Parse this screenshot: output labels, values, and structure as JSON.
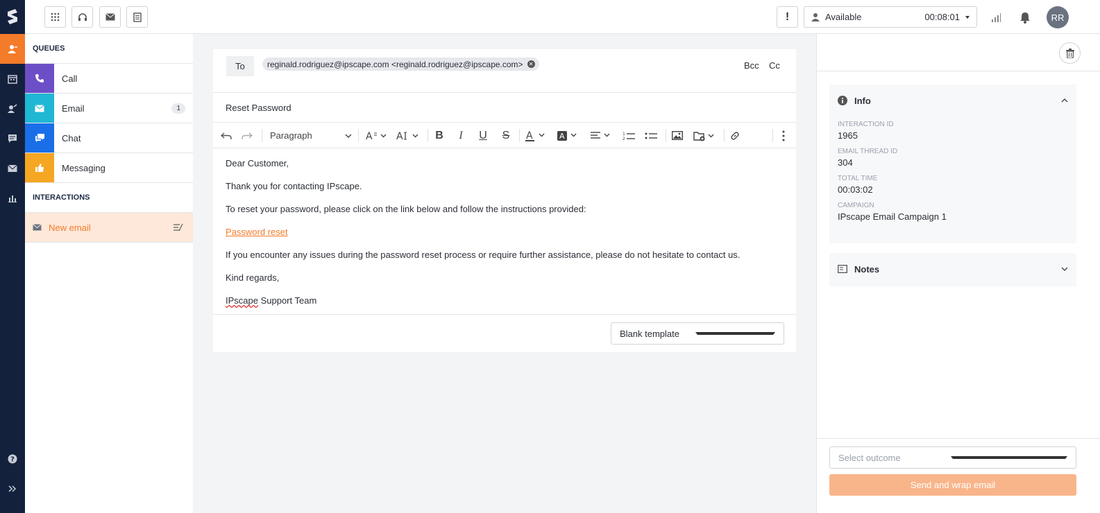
{
  "rail": {
    "logo": "s-logo-icon",
    "items": [
      "contact-icon",
      "calendar-icon",
      "agent-icon",
      "chat-icon",
      "email-icon",
      "reports-icon"
    ],
    "bottom": [
      "help-icon",
      "expand-icon"
    ]
  },
  "topbar": {
    "warning": "!",
    "status_label": "Available",
    "status_timer": "00:08:01",
    "avatar_initials": "RR"
  },
  "queues": {
    "heading": "QUEUES",
    "items": [
      {
        "label": "Call",
        "color": "#6c4fc7",
        "icon": "phone-icon"
      },
      {
        "label": "Email",
        "color": "#1fb7d4",
        "icon": "email-icon",
        "badge": "1"
      },
      {
        "label": "Chat",
        "color": "#1a6fe8",
        "icon": "chat-icon"
      },
      {
        "label": "Messaging",
        "color": "#f5a623",
        "icon": "thumbs-up-icon"
      }
    ]
  },
  "interactions": {
    "heading": "INTERACTIONS",
    "items": [
      {
        "label": "New email"
      }
    ]
  },
  "composer": {
    "to_label": "To",
    "recipient": "reginald.rodriguez@ipscape.com <reginald.rodriguez@ipscape.com>",
    "bcc": "Bcc",
    "cc": "Cc",
    "subject": "Reset Password",
    "paragraph_style": "Paragraph",
    "body": {
      "greeting": "Dear Customer,",
      "line1": "Thank you for contacting IPscape.",
      "line2": "To reset your password, please click on the link below and follow the instructions provided:",
      "link": "Password reset",
      "line3": "If you encounter any issues during the password reset process or require further assistance, please do not hesitate to contact us.",
      "closing": "Kind regards,",
      "signature_word": "IPscape",
      "signature_rest": " Support Team"
    },
    "template": "Blank template"
  },
  "details": {
    "info_title": "Info",
    "fields": [
      {
        "label": "INTERACTION ID",
        "value": "1965"
      },
      {
        "label": "EMAIL THREAD ID",
        "value": "304"
      },
      {
        "label": "TOTAL TIME",
        "value": "00:03:02"
      },
      {
        "label": "CAMPAIGN",
        "value": "IPscape Email Campaign 1"
      }
    ],
    "notes_title": "Notes",
    "outcome_placeholder": "Select outcome",
    "send_label": "Send and wrap email"
  },
  "colors": {
    "accent": "#f47b2a",
    "rail": "#14213d",
    "send_disabled": "#f9b58a"
  }
}
